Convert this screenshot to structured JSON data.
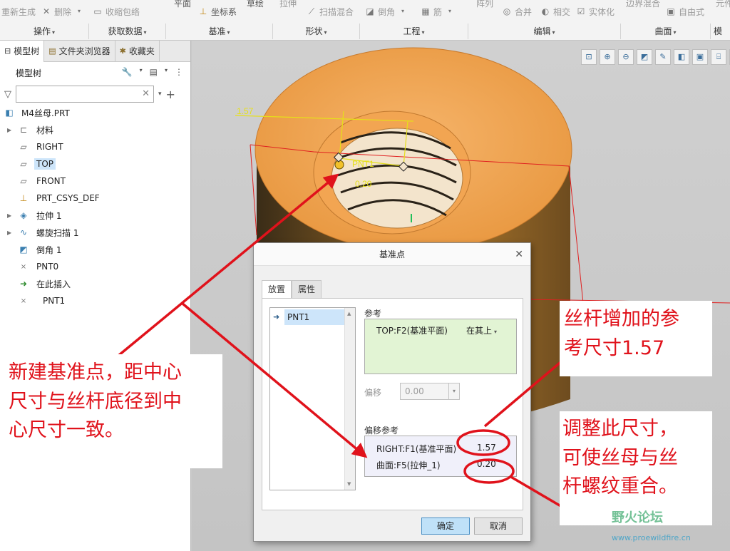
{
  "ribbon": {
    "tools": {
      "regen": "重新生成",
      "delete": "删除",
      "shrinkwrap": "收缩包络",
      "plane": "平面",
      "csys": "坐标系",
      "sketch": "草绘",
      "extrude": "拉伸",
      "sweep_blend": "扫描混合",
      "round": "倒角",
      "rib": "筋",
      "pattern": "阵列",
      "merge": "合并",
      "intersect": "相交",
      "solidify": "实体化",
      "boundary_blend": "边界混合",
      "freestyle": "自由式",
      "more": "元件"
    },
    "groups": {
      "operations": "操作",
      "get_data": "获取数据",
      "datum": "基准",
      "shapes": "形状",
      "engineering": "工程",
      "editing": "编辑",
      "surfaces": "曲面",
      "model_intent": "模型"
    }
  },
  "left_panel": {
    "tabs": {
      "model_tree": "模型树",
      "folder_browser": "文件夹浏览器",
      "favorites": "收藏夹"
    },
    "header": "模型树",
    "filter_placeholder": "",
    "tree": {
      "root": "M4丝母.PRT",
      "items": [
        "材料",
        "RIGHT",
        "TOP",
        "FRONT",
        "PRT_CSYS_DEF",
        "拉伸 1",
        "螺旋扫描 1",
        "倒角 1",
        "PNT0",
        "在此插入",
        "PNT1"
      ]
    }
  },
  "viewport": {
    "dims": {
      "d1": "1.57",
      "d2": "0.20",
      "point_label": "PNT1"
    }
  },
  "dialog": {
    "title": "基准点",
    "tabs": {
      "placement": "放置",
      "properties": "属性"
    },
    "point_list": [
      "PNT1"
    ],
    "references_label": "参考",
    "reference_value": "TOP:F2(基准平面)",
    "reference_constraint": "在其上",
    "offset_label": "偏移",
    "offset_value": "0.00",
    "offset_refs_label": "偏移参考",
    "offset_refs": [
      {
        "ref": "RIGHT:F1(基准平面)",
        "value": "1.57"
      },
      {
        "ref": "曲面:F5(拉伸_1)",
        "value": "0.20"
      }
    ],
    "ok": "确定",
    "cancel": "取消"
  },
  "annotations": {
    "left_note": [
      "新建基准点，距中心",
      "尺寸与丝杆底径到中",
      "心尺寸一致。"
    ],
    "top_right_note": [
      "丝杆增加的参",
      "考尺寸1.57"
    ],
    "bottom_right_note": [
      "调整此尺寸，",
      "可使丝母与丝",
      "杆螺纹重合。"
    ],
    "color": "#e0121b"
  },
  "watermark": {
    "text": "野火论坛",
    "url": "www.proewildfire.cn"
  }
}
